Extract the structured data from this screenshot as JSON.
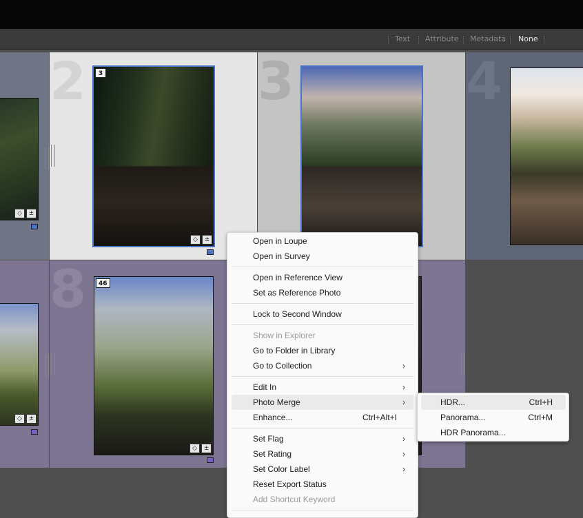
{
  "filter_bar": {
    "items": [
      {
        "label": "Text",
        "active": false
      },
      {
        "label": "Attribute",
        "active": false
      },
      {
        "label": "Metadata",
        "active": false
      },
      {
        "label": "None",
        "active": true
      }
    ]
  },
  "grid": {
    "cells": [
      {
        "cell_number": "2",
        "badge": "3",
        "selected": true
      },
      {
        "cell_number": "3",
        "badge": "",
        "selected": true
      },
      {
        "cell_number": "4",
        "badge": "",
        "selected": false
      },
      {
        "cell_number": "8",
        "badge": "46",
        "selected": false
      }
    ],
    "colors": {
      "cell_light": "#e6e6e6",
      "cell_mid": "#c4c4c4",
      "cell_slate": "#5d6577",
      "cell_purple": "#7d7592",
      "selection_border": "#4a73c8",
      "label_blue": "#4a73c8",
      "label_purple": "#7a5fc4"
    }
  },
  "context_menu": {
    "open_in_loupe": "Open in Loupe",
    "open_in_survey": "Open in Survey",
    "open_in_reference_view": "Open in Reference View",
    "set_as_reference_photo": "Set as Reference Photo",
    "lock_to_second_window": "Lock to Second Window",
    "show_in_explorer": "Show in Explorer",
    "go_to_folder_in_library": "Go to Folder in Library",
    "go_to_collection": "Go to Collection",
    "edit_in": "Edit In",
    "photo_merge": "Photo Merge",
    "enhance": "Enhance...",
    "enhance_shortcut": "Ctrl+Alt+I",
    "set_flag": "Set Flag",
    "set_rating": "Set Rating",
    "set_color_label": "Set Color Label",
    "reset_export_status": "Reset Export Status",
    "add_shortcut_keyword": "Add Shortcut Keyword"
  },
  "photo_merge_submenu": {
    "hdr": "HDR...",
    "hdr_shortcut": "Ctrl+H",
    "panorama": "Panorama...",
    "panorama_shortcut": "Ctrl+M",
    "hdr_panorama": "HDR Panorama..."
  }
}
